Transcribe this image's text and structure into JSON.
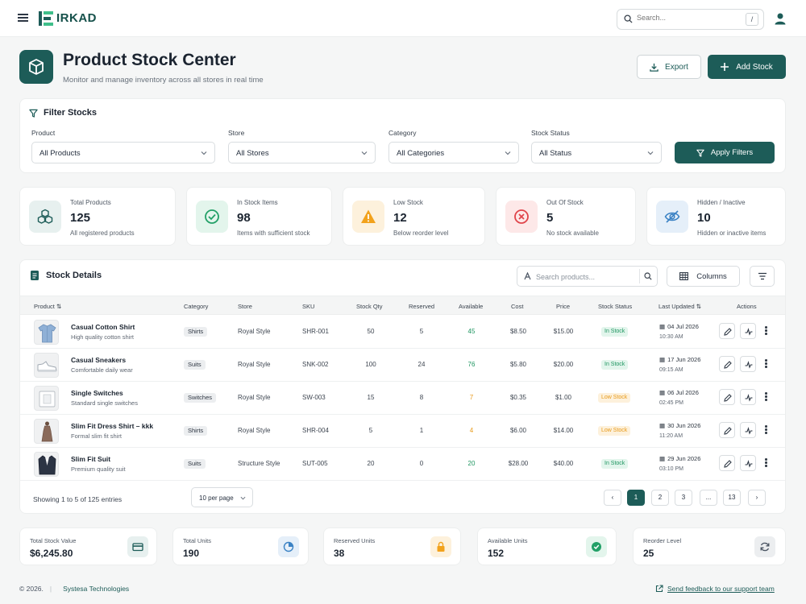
{
  "app": {
    "logo_text": "IRKAD"
  },
  "search": {
    "placeholder": "Search...",
    "shortcut": "/"
  },
  "header": {
    "title": "Product Stock Center",
    "subtitle": "Monitor and manage inventory across all stores in real time",
    "export_label": "Export",
    "add_label": "Add Stock"
  },
  "filters": {
    "title": "Filter Stocks",
    "product": {
      "label": "Product",
      "value": "All Products"
    },
    "store": {
      "label": "Store",
      "value": "All Stores"
    },
    "category": {
      "label": "Category",
      "value": "All Categories"
    },
    "status": {
      "label": "Stock Status",
      "value": "All Status"
    },
    "apply_label": "Apply Filters"
  },
  "stats": [
    {
      "label": "Total Products",
      "value": "125",
      "desc": "All registered products",
      "icon": "cubes-icon",
      "color": "#1d5c58"
    },
    {
      "label": "In Stock Items",
      "value": "98",
      "desc": "Items with sufficient stock",
      "icon": "check-circle-icon",
      "color": "#22a067"
    },
    {
      "label": "Low Stock",
      "value": "12",
      "desc": "Below reorder level",
      "icon": "warning-icon",
      "color": "#f2a21c"
    },
    {
      "label": "Out Of Stock",
      "value": "5",
      "desc": "No stock available",
      "icon": "x-circle-icon",
      "color": "#e0444a"
    },
    {
      "label": "Hidden / Inactive",
      "value": "10",
      "desc": "Hidden or inactive items",
      "icon": "eye-off-icon",
      "color": "#3b82c4"
    }
  ],
  "details": {
    "title": "Stock Details",
    "search_placeholder": "Search products...",
    "columns_label": "Columns",
    "headers": [
      "Product",
      "Category",
      "Store",
      "SKU",
      "Stock Qty",
      "Reserved",
      "Available",
      "Cost",
      "Price",
      "Stock Status",
      "Last Updated",
      "Actions"
    ],
    "rows": [
      {
        "name": "Casual Cotton Shirt",
        "desc": "High quality cotton shirt",
        "category": "Shirts",
        "store": "Royal Style",
        "sku": "SHR-001",
        "qty": "50",
        "reserved": "5",
        "available": "45",
        "cost": "$8.50",
        "price": "$15.00",
        "status": "In Stock",
        "date": "04 Jul 2026",
        "time": "10:30 AM"
      },
      {
        "name": "Casual Sneakers",
        "desc": "Comfortable daily wear",
        "category": "Suits",
        "store": "Royal Style",
        "sku": "SNK-002",
        "qty": "100",
        "reserved": "24",
        "available": "76",
        "cost": "$5.80",
        "price": "$20.00",
        "status": "In Stock",
        "date": "17 Jun 2026",
        "time": "09:15 AM"
      },
      {
        "name": "Single Switches",
        "desc": "Standard single switches",
        "category": "Switches",
        "store": "Royal Style",
        "sku": "SW-003",
        "qty": "15",
        "reserved": "8",
        "available": "7",
        "cost": "$0.35",
        "price": "$1.00",
        "status": "Low Stock",
        "date": "06 Jul 2026",
        "time": "02:45 PM"
      },
      {
        "name": "Slim Fit Dress Shirt – kkk",
        "desc": "Formal slim fit shirt",
        "category": "Shirts",
        "store": "Royal Style",
        "sku": "SHR-004",
        "qty": "5",
        "reserved": "1",
        "available": "4",
        "cost": "$6.00",
        "price": "$14.00",
        "status": "Low Stock",
        "date": "30 Jun 2026",
        "time": "11:20 AM"
      },
      {
        "name": "Slim Fit Suit",
        "desc": "Premium quality suit",
        "category": "Suits",
        "store": "Structure Style",
        "sku": "SUT-005",
        "qty": "20",
        "reserved": "0",
        "available": "20",
        "cost": "$28.00",
        "price": "$40.00",
        "status": "In Stock",
        "date": "29 Jun 2026",
        "time": "03:10 PM"
      }
    ],
    "showing": "Showing 1 to 5 of 125 entries",
    "per_page": "10 per page",
    "pages": [
      "1",
      "2",
      "3",
      "...",
      "13"
    ]
  },
  "summary": [
    {
      "label": "Total Stock Value",
      "value": "$6,245.80",
      "icon": "card-icon",
      "color": "#1d5c58"
    },
    {
      "label": "Total Units",
      "value": "190",
      "icon": "pie-icon",
      "color": "#3b82c4"
    },
    {
      "label": "Reserved Units",
      "value": "38",
      "icon": "lock-icon",
      "color": "#f2a21c"
    },
    {
      "label": "Available Units",
      "value": "152",
      "icon": "check-badge-icon",
      "color": "#22a067"
    },
    {
      "label": "Reorder Level",
      "value": "25",
      "icon": "refresh-icon",
      "color": "#4b5563"
    }
  ],
  "footer": {
    "copyright": "© 2026.",
    "company": "Systesa Technologies",
    "feedback": "Send feedback to our support team"
  }
}
